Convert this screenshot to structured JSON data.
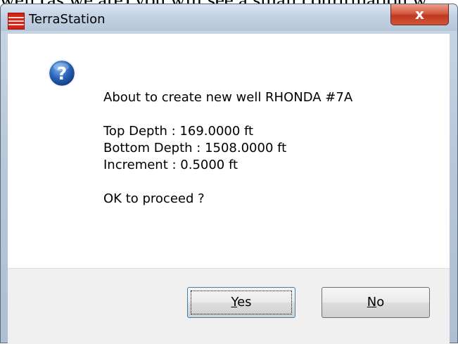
{
  "document": {
    "partial_text": "well (as we are) you will see a small confirmation w"
  },
  "window": {
    "title": "TerraStation",
    "close_glyph": "x",
    "app_icon": "terrastation-icon"
  },
  "message": {
    "icon": "question-icon",
    "line1": "About to create new well RHONDA #7A",
    "top_depth": "Top Depth : 169.0000 ft",
    "bottom_depth": "Bottom Depth : 1508.0000 ft",
    "increment": "Increment : 0.5000 ft",
    "prompt": "OK to proceed ?"
  },
  "buttons": {
    "yes_mnemonic": "Y",
    "yes_rest": "es",
    "no_mnemonic": "N",
    "no_rest": "o"
  },
  "colors": {
    "question_icon": "#2a63b8",
    "app_icon": "#d62418",
    "close_button": "#c8432a"
  }
}
